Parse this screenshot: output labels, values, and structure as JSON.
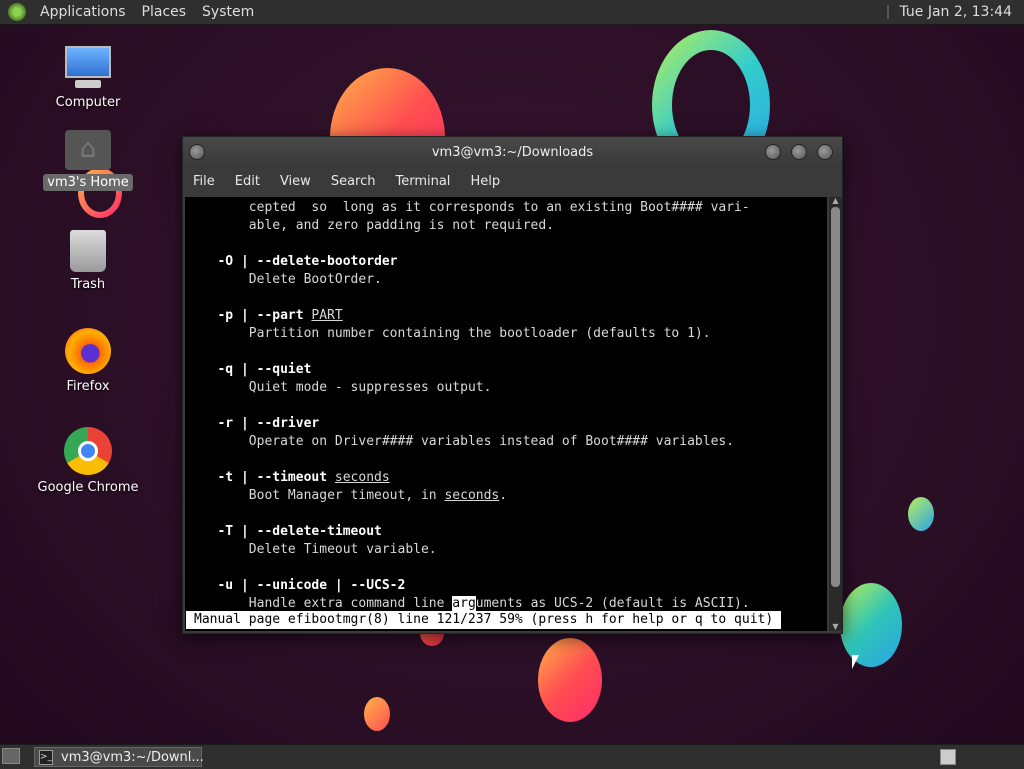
{
  "top_panel": {
    "menu": [
      "Applications",
      "Places",
      "System"
    ],
    "clock": "Tue Jan  2, 13:44"
  },
  "desktop": {
    "icons": [
      {
        "label": "Computer",
        "icon": "computer-icon"
      },
      {
        "label": "vm3's Home",
        "icon": "home-folder-icon",
        "selected": true
      },
      {
        "label": "Trash",
        "icon": "trash-icon"
      },
      {
        "label": "Firefox",
        "icon": "firefox-icon"
      },
      {
        "label": "Google Chrome",
        "icon": "chrome-icon"
      }
    ]
  },
  "window": {
    "title": "vm3@vm3:~/Downloads",
    "menu": [
      "File",
      "Edit",
      "View",
      "Search",
      "Terminal",
      "Help"
    ],
    "terminal_lines": [
      {
        "indent": "       ",
        "segments": [
          {
            "t": "cepted  so  long as it corresponds to an existing Boot#### vari-"
          }
        ]
      },
      {
        "indent": "       ",
        "segments": [
          {
            "t": "able, and zero padding is not required."
          }
        ]
      },
      {
        "indent": "",
        "segments": [
          {
            "t": ""
          }
        ]
      },
      {
        "indent": "   ",
        "segments": [
          {
            "t": "-O | --delete-bootorder",
            "b": true
          }
        ]
      },
      {
        "indent": "       ",
        "segments": [
          {
            "t": "Delete BootOrder."
          }
        ]
      },
      {
        "indent": "",
        "segments": [
          {
            "t": ""
          }
        ]
      },
      {
        "indent": "   ",
        "segments": [
          {
            "t": "-p | --part",
            "b": true
          },
          {
            "t": " "
          },
          {
            "t": "PART",
            "u": true
          }
        ]
      },
      {
        "indent": "       ",
        "segments": [
          {
            "t": "Partition number containing the bootloader (defaults to 1)."
          }
        ]
      },
      {
        "indent": "",
        "segments": [
          {
            "t": ""
          }
        ]
      },
      {
        "indent": "   ",
        "segments": [
          {
            "t": "-q | --quiet",
            "b": true
          }
        ]
      },
      {
        "indent": "       ",
        "segments": [
          {
            "t": "Quiet mode - suppresses output."
          }
        ]
      },
      {
        "indent": "",
        "segments": [
          {
            "t": ""
          }
        ]
      },
      {
        "indent": "   ",
        "segments": [
          {
            "t": "-r | --driver",
            "b": true
          }
        ]
      },
      {
        "indent": "       ",
        "segments": [
          {
            "t": "Operate on Driver#### variables instead of Boot#### variables."
          }
        ]
      },
      {
        "indent": "",
        "segments": [
          {
            "t": ""
          }
        ]
      },
      {
        "indent": "   ",
        "segments": [
          {
            "t": "-t | --timeout",
            "b": true
          },
          {
            "t": " "
          },
          {
            "t": "seconds",
            "u": true
          }
        ]
      },
      {
        "indent": "       ",
        "segments": [
          {
            "t": "Boot Manager timeout, in "
          },
          {
            "t": "seconds",
            "u": true
          },
          {
            "t": "."
          }
        ]
      },
      {
        "indent": "",
        "segments": [
          {
            "t": ""
          }
        ]
      },
      {
        "indent": "   ",
        "segments": [
          {
            "t": "-T | --delete-timeout",
            "b": true
          }
        ]
      },
      {
        "indent": "       ",
        "segments": [
          {
            "t": "Delete Timeout variable."
          }
        ]
      },
      {
        "indent": "",
        "segments": [
          {
            "t": ""
          }
        ]
      },
      {
        "indent": "   ",
        "segments": [
          {
            "t": "-u | --unicode | --UCS-2",
            "b": true
          }
        ]
      },
      {
        "indent": "       ",
        "segments": [
          {
            "t": "Handle extra command line "
          },
          {
            "t": "arg",
            "cur": true
          },
          {
            "t": "uments as UCS-2 (default is ASCII)."
          }
        ]
      }
    ],
    "status_line": "Manual page efibootmgr(8) line 121/237 59% (press h for help or q to quit)"
  },
  "bottom_panel": {
    "task_label": "vm3@vm3:~/Downl..."
  }
}
